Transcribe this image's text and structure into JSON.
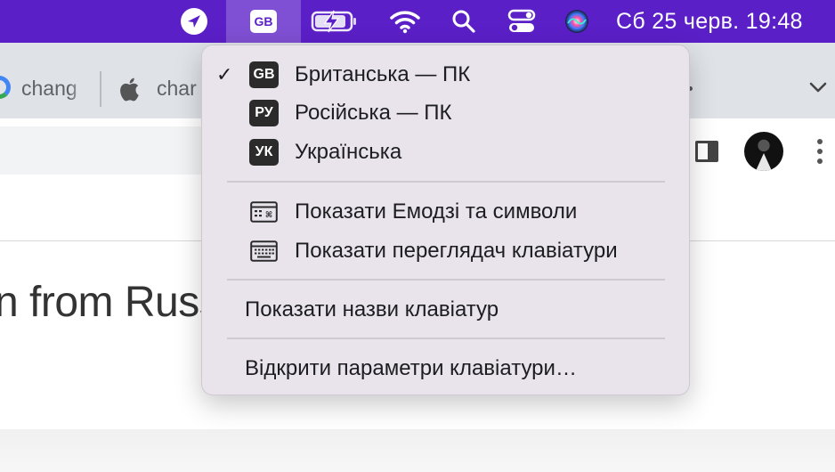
{
  "menubar": {
    "icons": [
      "location-arrow-icon",
      "input-source-icon",
      "battery-charging-icon",
      "wifi-icon",
      "search-icon",
      "control-center-icon",
      "siri-icon"
    ],
    "input_source_badge": "GB",
    "clock": "Сб 25 черв.  19:48",
    "accent_color": "#5b1fc7"
  },
  "browser": {
    "tabs": [
      {
        "label": "chang",
        "icon": "google-icon"
      },
      {
        "label": "char",
        "icon": "apple-icon"
      }
    ]
  },
  "page": {
    "heading_fragment": "n from Russ"
  },
  "input_menu": {
    "languages": [
      {
        "badge": "GB",
        "label": "Британська — ПК",
        "checked": true
      },
      {
        "badge": "РУ",
        "label": "Російська — ПК",
        "checked": false
      },
      {
        "badge": "УК",
        "label": "Українська",
        "checked": false
      }
    ],
    "tools": [
      {
        "icon": "emoji-viewer-icon",
        "label": "Показати Емодзі та символи"
      },
      {
        "icon": "keyboard-viewer-icon",
        "label": "Показати переглядач клавіатури"
      }
    ],
    "show_names": "Показати назви клавіатур",
    "open_settings": "Відкрити параметри клавіатури…",
    "checkmark": "✓"
  }
}
